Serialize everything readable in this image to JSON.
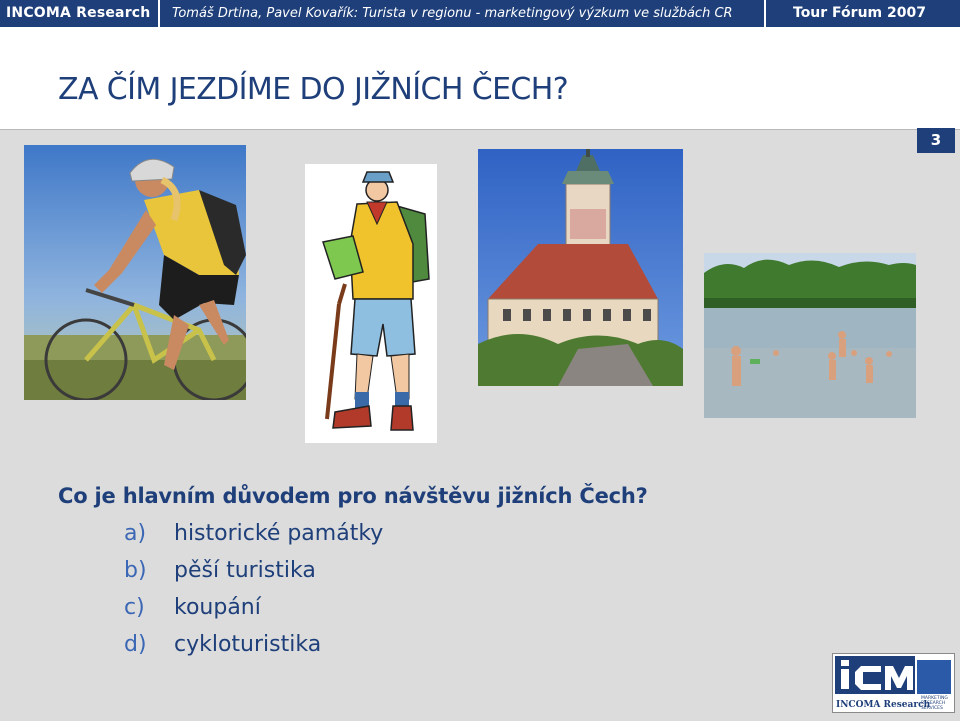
{
  "header": {
    "left": "INCOMA  Research",
    "middle": "Tomáš Drtina, Pavel Kovařík: Turista v regionu - marketingový výzkum ve službách  CR",
    "right": "Tour Fórum 2007"
  },
  "title": "ZA ČÍM JEZDÍME DO JIŽNÍCH ČECH?",
  "slide_number": "3",
  "images": [
    "cyclist-photo",
    "hiker-illustration",
    "castle-tower-photo",
    "swimmers-lake-photo"
  ],
  "question": "Co je hlavním důvodem pro návštěvu jižních Čech?",
  "options": [
    {
      "letter": "a)",
      "text": "historické památky"
    },
    {
      "letter": "b)",
      "text": "pěší turistika"
    },
    {
      "letter": "c)",
      "text": "koupání"
    },
    {
      "letter": "d)",
      "text": "cykloturistika"
    }
  ],
  "logo": {
    "mark": "iCM",
    "name": "INCOMA Research",
    "side": "MARKETING RESEARCH SERVICES"
  },
  "colors": {
    "brand": "#1e3f7a",
    "accent": "#3b67b5",
    "panel": "#dcdcdc"
  }
}
